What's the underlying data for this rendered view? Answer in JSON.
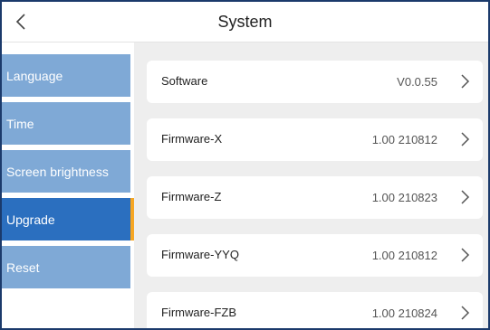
{
  "header": {
    "title": "System",
    "back_icon": "chevron-left-icon"
  },
  "sidebar": {
    "items": [
      {
        "label": "Language",
        "active": false
      },
      {
        "label": "Time",
        "active": false
      },
      {
        "label": "Screen brightness",
        "active": false
      },
      {
        "label": "Upgrade",
        "active": true
      },
      {
        "label": "Reset",
        "active": false
      }
    ]
  },
  "content": {
    "rows": [
      {
        "label": "Software",
        "value": "V0.0.55"
      },
      {
        "label": "Firmware-X",
        "value": "1.00 210812"
      },
      {
        "label": "Firmware-Z",
        "value": "1.00 210823"
      },
      {
        "label": "Firmware-YYQ",
        "value": "1.00 210812"
      },
      {
        "label": "Firmware-FZB",
        "value": "1.00 210824"
      }
    ]
  },
  "colors": {
    "sidebar_item": "#7fa9d6",
    "sidebar_active": "#2b6fbf",
    "active_indicator": "#f6a623",
    "content_bg": "#eeeeee"
  }
}
